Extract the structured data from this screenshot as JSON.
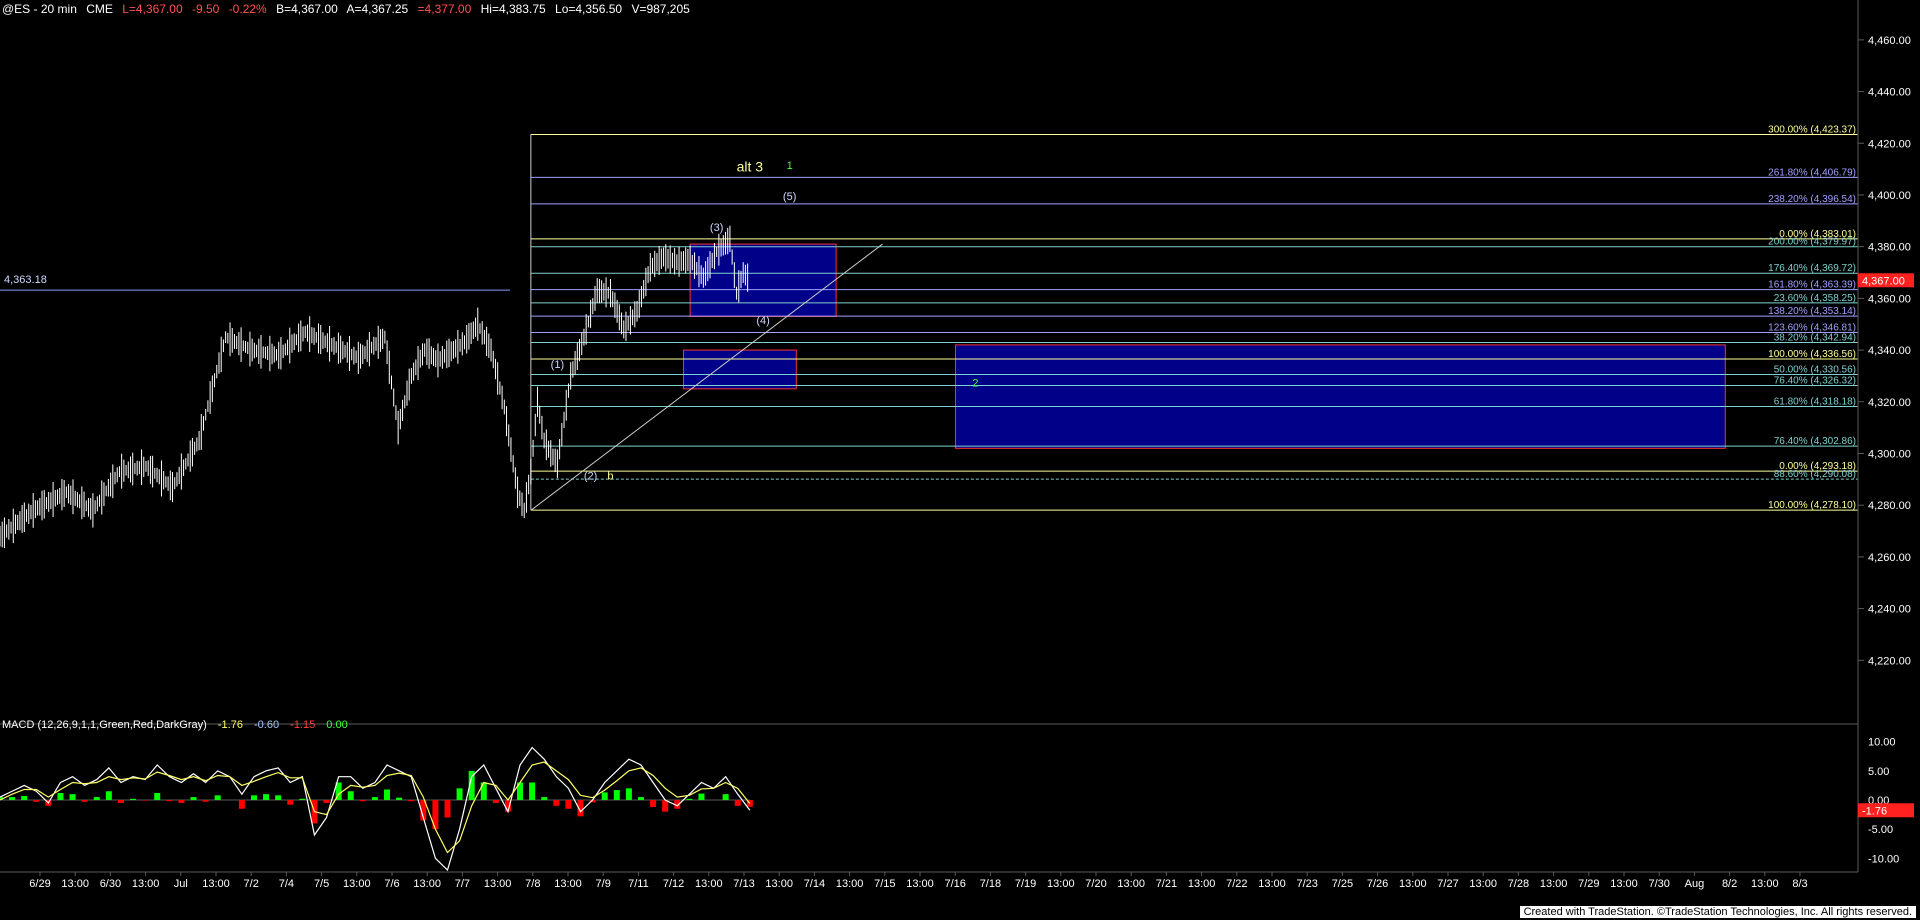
{
  "header": {
    "symbol": "@ES - 20 min",
    "exchange": "CME",
    "last": "L=4,367.00",
    "change": "-9.50",
    "change_pct": "-0.22%",
    "bid": "B=4,367.00",
    "ask": "A=4,367.25",
    "open": "=4,377.00",
    "high": "Hi=4,383.75",
    "low": "Lo=4,356.50",
    "volume": "V=987,205"
  },
  "left_level_label": "4,363.18",
  "last_price_tag": "4,367.00",
  "macd_header": {
    "name": "MACD (12,26,9,1,1,Green,Red,DarkGray)",
    "v1": "-1.76",
    "v2": "-0.60",
    "v3": "-1.15",
    "v4": "0.00"
  },
  "footer": "Created with TradeStation. ©TradeStation Technologies, Inc. All rights reserved.",
  "colors": {
    "background": "#000000",
    "price_bar": "#ffffff",
    "grid": "#5a5a5a",
    "fib_yellow": "#ffff99",
    "fib_blue": "#a0a0ff",
    "fib_teal": "#7fcfcf",
    "box_fill": "#000088",
    "box_border": "#ff3030",
    "macd_line": "#ffffff",
    "signal_line": "#ffff66",
    "hist_pos": "#00ff00",
    "hist_neg": "#ff0000",
    "last_tag": "#ff2020"
  },
  "chart_data": [
    {
      "type": "candlestick-bar",
      "title": "@ES - 20 min",
      "x_ticks": [
        "6/29",
        "13:00",
        "6/30",
        "13:00",
        "Jul",
        "13:00",
        "7/2",
        "7/4",
        "7/5",
        "13:00",
        "7/6",
        "13:00",
        "7/7",
        "13:00",
        "7/8",
        "13:00",
        "7/9",
        "7/11",
        "7/12",
        "13:00",
        "7/13",
        "13:00",
        "7/14",
        "13:00",
        "7/15",
        "13:00",
        "7/16",
        "7/18",
        "7/19",
        "13:00",
        "7/20",
        "13:00",
        "7/21",
        "13:00",
        "7/22",
        "13:00",
        "7/23",
        "7/25",
        "7/26",
        "13:00",
        "7/27",
        "13:00",
        "7/28",
        "13:00",
        "7/29",
        "13:00",
        "7/30",
        "Aug",
        "8/2",
        "13:00",
        "8/3"
      ],
      "y_ticks": [
        "4,460.00",
        "4,440.00",
        "4,420.00",
        "4,400.00",
        "4,380.00",
        "4,360.00",
        "4,340.00",
        "4,320.00",
        "4,300.00",
        "4,280.00",
        "4,260.00",
        "4,240.00",
        "4,220.00"
      ],
      "ylim": [
        4200,
        4470
      ],
      "price_path": [
        [
          0,
          4268
        ],
        [
          5,
          4278
        ],
        [
          10,
          4285
        ],
        [
          14,
          4278
        ],
        [
          18,
          4293
        ],
        [
          22,
          4295
        ],
        [
          26,
          4287
        ],
        [
          30,
          4305
        ],
        [
          34,
          4345
        ],
        [
          38,
          4340
        ],
        [
          42,
          4338
        ],
        [
          46,
          4347
        ],
        [
          50,
          4342
        ],
        [
          54,
          4337
        ],
        [
          58,
          4345
        ],
        [
          60,
          4310
        ],
        [
          62,
          4330
        ],
        [
          64,
          4340
        ],
        [
          66,
          4336
        ],
        [
          70,
          4343
        ],
        [
          72,
          4350
        ],
        [
          74,
          4340
        ],
        [
          76,
          4318
        ],
        [
          78,
          4285
        ],
        [
          79,
          4278
        ],
        [
          80,
          4293
        ],
        [
          81,
          4320
        ],
        [
          82,
          4305
        ],
        [
          83,
          4300
        ],
        [
          84,
          4296
        ],
        [
          86,
          4330
        ],
        [
          88,
          4345
        ],
        [
          90,
          4363
        ],
        [
          92,
          4362
        ],
        [
          94,
          4348
        ],
        [
          96,
          4355
        ],
        [
          98,
          4372
        ],
        [
          100,
          4376
        ],
        [
          102,
          4374
        ],
        [
          104,
          4375
        ],
        [
          106,
          4368
        ],
        [
          108,
          4378
        ],
        [
          110,
          4383
        ],
        [
          111,
          4362
        ],
        [
          112,
          4370
        ],
        [
          113,
          4367
        ]
      ],
      "box_area_notes": "Wave count labels drawn on chart",
      "wave_labels": [
        "(1)",
        "(2)",
        "b",
        "(3)",
        "(4)",
        "(5)",
        "alt 3",
        "1",
        "2"
      ],
      "fib_levels": [
        {
          "label": "300.00% (4,423.37)",
          "value": 4423.37
        },
        {
          "label": "261.80% (4,406.79)",
          "value": 4406.79
        },
        {
          "label": "238.20% (4,396.54)",
          "value": 4396.54
        },
        {
          "label": "0.00% (4,383.01)",
          "value": 4383.01
        },
        {
          "label": "200.00% (4,379.97)",
          "value": 4379.97
        },
        {
          "label": "176.40% (4,369.72)",
          "value": 4369.72
        },
        {
          "label": "161.80% (4,363.39)",
          "value": 4363.39
        },
        {
          "label": "23.60% (4,358.25)",
          "value": 4358.25
        },
        {
          "label": "138.20% (4,353.14)",
          "value": 4353.14
        },
        {
          "label": "123.60% (4,346.81)",
          "value": 4346.81
        },
        {
          "label": "38.20% (4,342.94)",
          "value": 4342.94
        },
        {
          "label": "100.00% (4,336.56)",
          "value": 4336.56
        },
        {
          "label": "50.00% (4,330.56)",
          "value": 4330.56
        },
        {
          "label": "76.40% (4,326.32)",
          "value": 4326.32
        },
        {
          "label": "61.80% (4,318.18)",
          "value": 4318.18
        },
        {
          "label": "76.40% (4,302.86)",
          "value": 4302.86
        },
        {
          "label": "0.00% (4,293.18)",
          "value": 4293.18
        },
        {
          "label": "88.60% (4,290.08)",
          "value": 4290.08
        },
        {
          "label": "100.00% (4,278.10)",
          "value": 4278.1
        }
      ],
      "boxes": [
        {
          "from_value": 4381,
          "to_value": 4353,
          "x_from": 104,
          "x_to": 126
        },
        {
          "from_value": 4340,
          "to_value": 4325,
          "x_from": 103,
          "x_to": 120
        },
        {
          "from_value": 4342,
          "to_value": 4302,
          "x_from": 144,
          "x_to": 260
        }
      ]
    },
    {
      "type": "line",
      "title": "MACD (12,26,9,1,1,Green,Red,DarkGray)",
      "y_ticks": [
        "10.00",
        "5.00",
        "0.00",
        "-5.00",
        "-10.00"
      ],
      "ylim": [
        -12,
        12
      ],
      "series": [
        {
          "name": "MACD",
          "values": [
            0.5,
            1.5,
            2.5,
            1.5,
            -0.5,
            3,
            4,
            2.5,
            3.5,
            5.5,
            3,
            4,
            3.5,
            6,
            4,
            3,
            4.5,
            3,
            5,
            4,
            1,
            4,
            5,
            5.5,
            3,
            4,
            -6,
            -3,
            4,
            4,
            2,
            3,
            6,
            5,
            4,
            -3,
            -10,
            -12,
            -5,
            4,
            6,
            2,
            -2,
            6,
            9,
            7,
            4,
            2,
            -2,
            0,
            3,
            5,
            7,
            6,
            3,
            0,
            -1,
            1,
            3,
            2,
            4,
            1,
            -1.76
          ]
        },
        {
          "name": "Signal",
          "values": [
            0,
            1,
            1.8,
            1.8,
            0.5,
            1.8,
            3,
            2.8,
            3,
            4,
            3.5,
            3.8,
            3.6,
            4.8,
            4.2,
            3.5,
            4,
            3.3,
            4.2,
            4,
            2.5,
            3.2,
            4,
            4.7,
            3.8,
            3.8,
            -2,
            -2.5,
            1,
            2.5,
            2.2,
            2.5,
            4.2,
            4.6,
            4.2,
            0.5,
            -5,
            -9,
            -7,
            -1,
            3,
            2.5,
            0,
            3,
            6,
            6.5,
            5,
            3.5,
            0.8,
            0.4,
            1.7,
            3.3,
            5,
            5.5,
            4.2,
            2,
            0.5,
            0.8,
            1.9,
            2,
            3,
            2,
            -0.6
          ]
        }
      ]
    }
  ]
}
